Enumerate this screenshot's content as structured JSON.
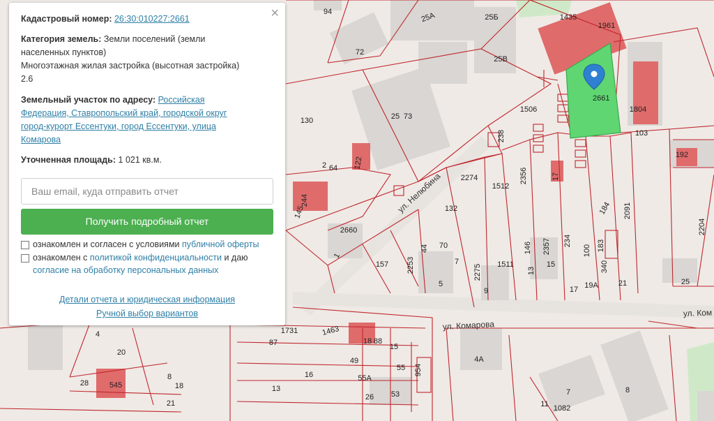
{
  "panel": {
    "close_icon": "×",
    "cadastral_label": "Кадастровый номер:",
    "cadastral_value": "26:30:010227:2661",
    "category_label": "Категория земель:",
    "category_value_1": "Земли поселений (земли",
    "category_value_2": "населенных пунктов)",
    "usage_line_1": "Многоэтажная жилая застройка (высотная застройка)",
    "usage_line_2": "2.6",
    "address_label": "Земельный участок по адресу:",
    "address_1": "Российская",
    "address_2": "Федерация, Ставропольский край, городской округ",
    "address_3": "город-курорт Ессентуки, город Ессентуки, улица",
    "address_4": "Комарова",
    "area_label": "Уточненная площадь:",
    "area_value": "1 021 кв.м.",
    "email_placeholder": "Ваш email, куда отправить отчет",
    "submit_label": "Получить подробный отчет",
    "consent1_text": "ознакомлен и согласен с условиями",
    "consent1_link": "публичной оферты",
    "consent2_text": "ознакомлен с",
    "consent2_link1": "политикой конфиденциальности",
    "consent2_mid": "и даю",
    "consent2_link2": "согласие на обработку персональных данных",
    "details_link": "Детали отчета и юридическая информация",
    "manual_link": "Ручной выбор вариантов"
  },
  "map": {
    "streets": [
      "ул. Нелюбина",
      "ул. Комарова",
      "ул. Ком"
    ],
    "selected_parcel": "2661",
    "marker_icon": "map-pin-icon",
    "colors": {
      "parcel_border": "#c0262d",
      "selected_fill": "#5fd672",
      "marker": "#2f80d1",
      "accent_button": "#4caf50",
      "link": "#2f7fa6"
    },
    "labels": [
      "94",
      "25А",
      "25Б",
      "1435",
      "1961",
      "72",
      "25В",
      "1506",
      "1804",
      "130",
      "25",
      "73",
      "103",
      "238",
      "192",
      "2",
      "64",
      "122",
      "2274",
      "1512",
      "2356",
      "17",
      "184",
      "2091",
      "2204",
      "244",
      "145",
      "2660",
      "132",
      "70",
      "44",
      "157",
      "2253",
      "1",
      "7",
      "2275",
      "1511",
      "146",
      "2357",
      "234",
      "100",
      "183",
      "340",
      "13",
      "15",
      "17",
      "19А",
      "21",
      "25",
      "5",
      "9",
      "4",
      "1731",
      "1463",
      "18",
      "88",
      "87",
      "15",
      "20",
      "49",
      "55",
      "954",
      "55А",
      "16",
      "8",
      "28",
      "545",
      "18",
      "13",
      "53",
      "4А",
      "8",
      "7",
      "21",
      "26",
      "11",
      "1082"
    ]
  }
}
